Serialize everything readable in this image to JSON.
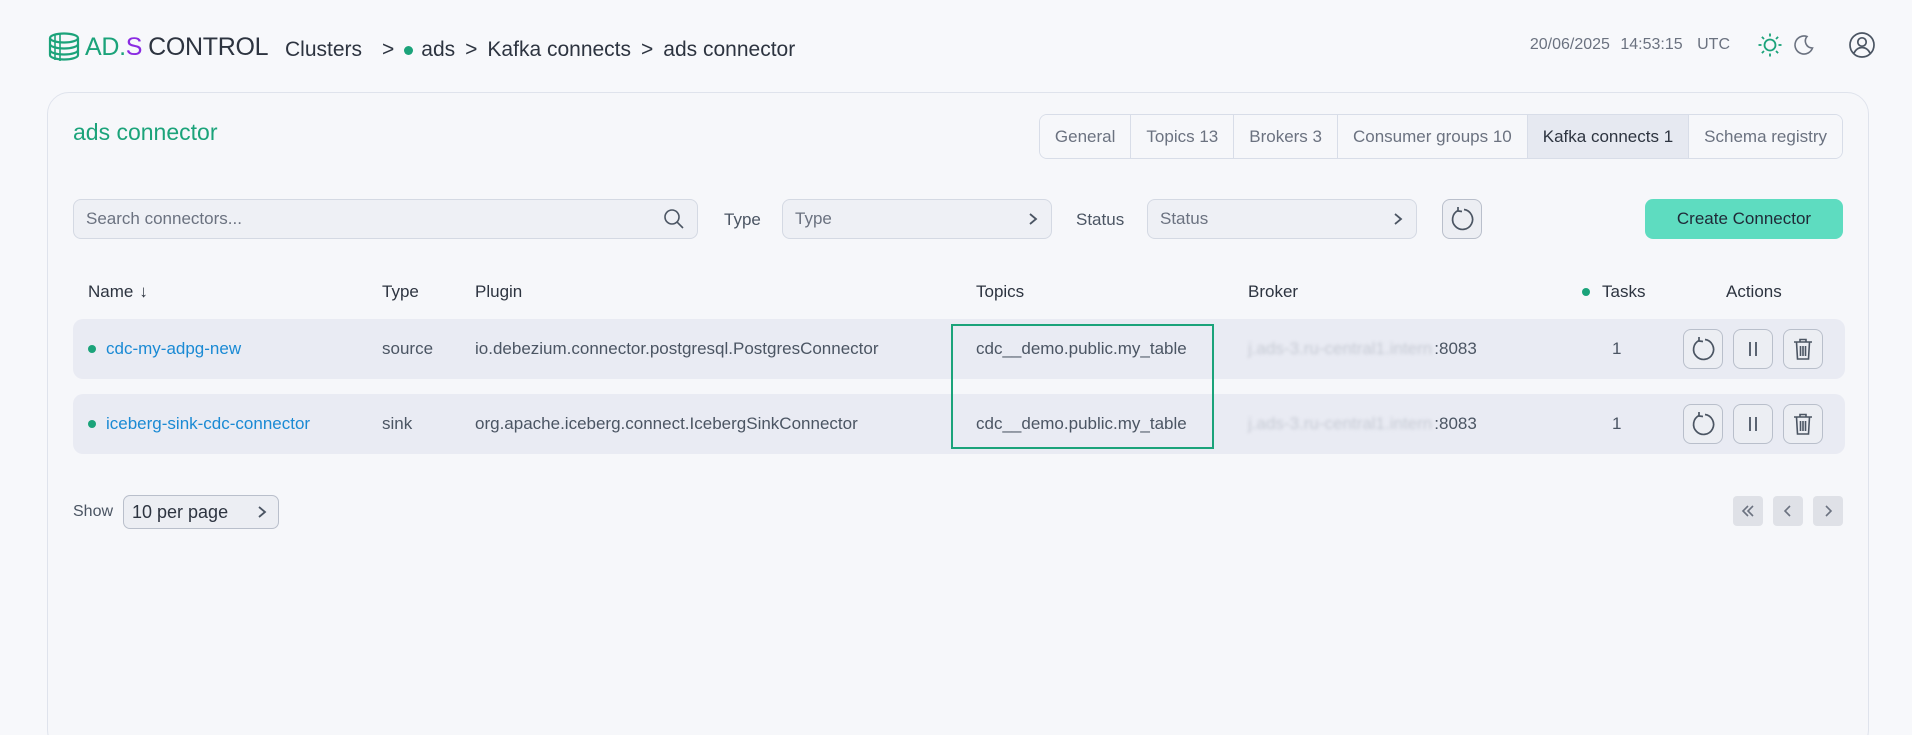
{
  "header": {
    "logo": {
      "part1": "AD.",
      "part2": "S",
      "part3": "CONTROL"
    },
    "breadcrumb": {
      "clusters": "Clusters",
      "sep": ">",
      "cluster": "ads",
      "section": "Kafka connects",
      "current": "ads connector"
    },
    "date": "20/06/2025",
    "time": "14:53:15",
    "timezone": "UTC",
    "icons": [
      "sun-icon",
      "moon-icon",
      "user-icon"
    ]
  },
  "page": {
    "title": "ads connector",
    "tabs": [
      {
        "label": "General",
        "active": false
      },
      {
        "label": "Topics 13",
        "active": false
      },
      {
        "label": "Brokers 3",
        "active": false
      },
      {
        "label": "Consumer groups 10",
        "active": false
      },
      {
        "label": "Kafka connects 1",
        "active": true
      },
      {
        "label": "Schema registry",
        "active": false
      }
    ]
  },
  "filters": {
    "search_placeholder": "Search connectors...",
    "type_label": "Type",
    "type_value": "Type",
    "status_label": "Status",
    "status_value": "Status",
    "create_label": "Create Connector"
  },
  "table": {
    "headers": {
      "name": "Name",
      "name_sort": "↓",
      "type": "Type",
      "plugin": "Plugin",
      "topics": "Topics",
      "broker": "Broker",
      "tasks": "Tasks",
      "actions": "Actions"
    },
    "rows": [
      {
        "name": "cdc-my-adpg-new",
        "type": "source",
        "plugin": "io.debezium.connector.postgresql.PostgresConnector",
        "topics": "cdc__demo.public.my_table",
        "broker_hidden": "j.ads-3.ru-central1.intern",
        "broker_port": ":8083",
        "tasks": "1"
      },
      {
        "name": "iceberg-sink-cdc-connector",
        "type": "sink",
        "plugin": "org.apache.iceberg.connect.IcebergSinkConnector",
        "topics": "cdc__demo.public.my_table",
        "broker_hidden": "j.ads-3.ru-central1.intern",
        "broker_port": ":8083",
        "tasks": "1"
      }
    ]
  },
  "pagination": {
    "show_label": "Show",
    "per_page": "10 per page"
  },
  "colors": {
    "accent": "#1ba37a",
    "link": "#1a8ad4",
    "create_button": "#5edcc0",
    "logo_purple": "#8a2be2"
  }
}
